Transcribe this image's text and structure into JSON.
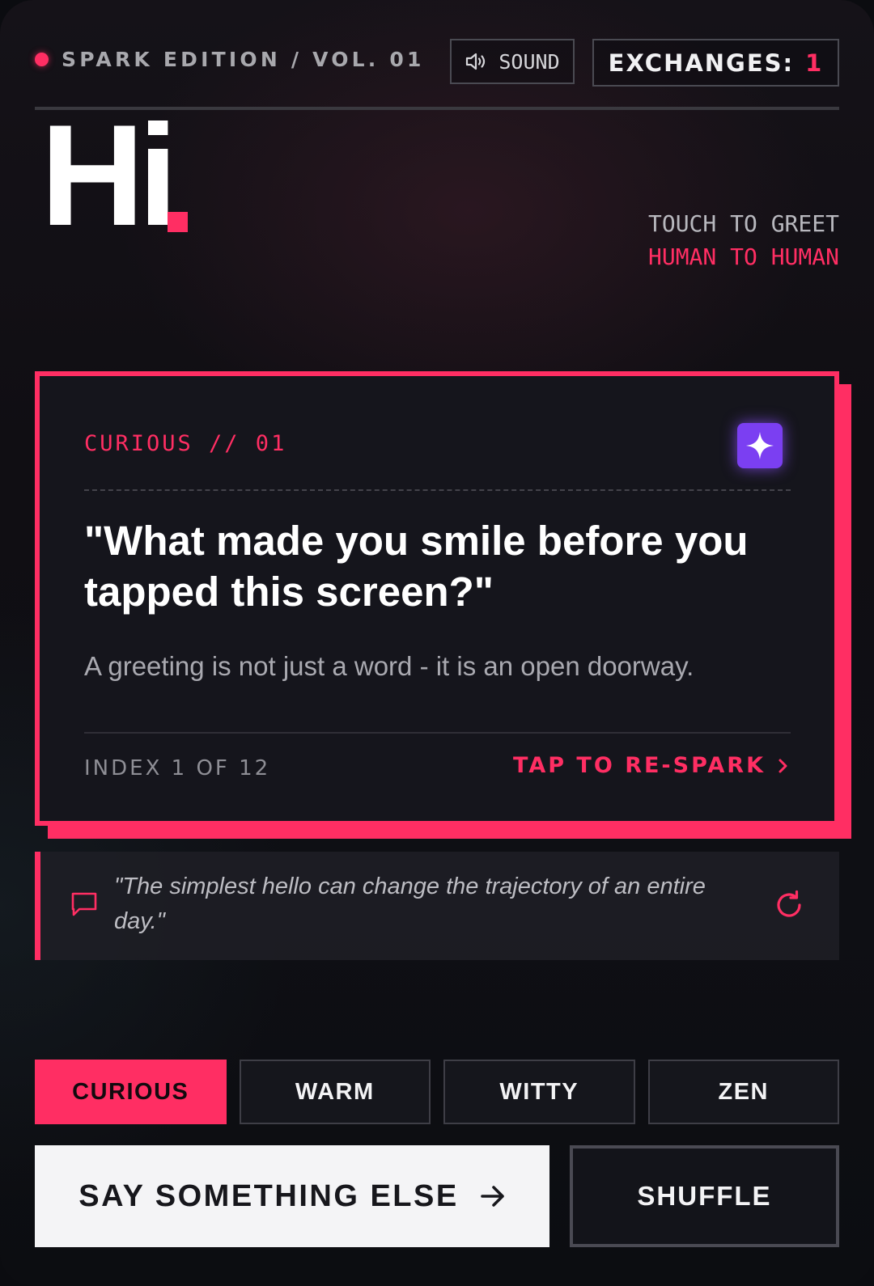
{
  "header": {
    "edition_label": "SPARK EDITION / VOL. 01",
    "sound_label": "SOUND",
    "exchanges_label": "EXCHANGES:",
    "exchanges_count": "1"
  },
  "hero": {
    "title": "Hi",
    "tagline_line1": "TOUCH TO GREET",
    "tagline_line2": "HUMAN TO HUMAN"
  },
  "card": {
    "category": "CURIOUS // 01",
    "icon": "sparkle-icon",
    "question": "\"What made you smile before you tapped this screen?\"",
    "subtext": "A greeting is not just a word - it is an open doorway.",
    "index_label": "INDEX 1 OF 12",
    "respark_label": "TAP TO RE-SPARK"
  },
  "quote": {
    "icon": "chat-bubble-icon",
    "text": "\"The simplest hello can change the trajectory of an entire day.\"",
    "refresh_icon": "refresh-icon"
  },
  "moods": {
    "items": [
      {
        "label": "CURIOUS",
        "active": true
      },
      {
        "label": "WARM",
        "active": false
      },
      {
        "label": "WITTY",
        "active": false
      },
      {
        "label": "ZEN",
        "active": false
      }
    ]
  },
  "actions": {
    "say_label": "SAY SOMETHING ELSE",
    "shuffle_label": "SHUFFLE"
  },
  "colors": {
    "accent": "#ff2e63",
    "sparkle": "#7b3ff2",
    "background": "#100e13"
  }
}
